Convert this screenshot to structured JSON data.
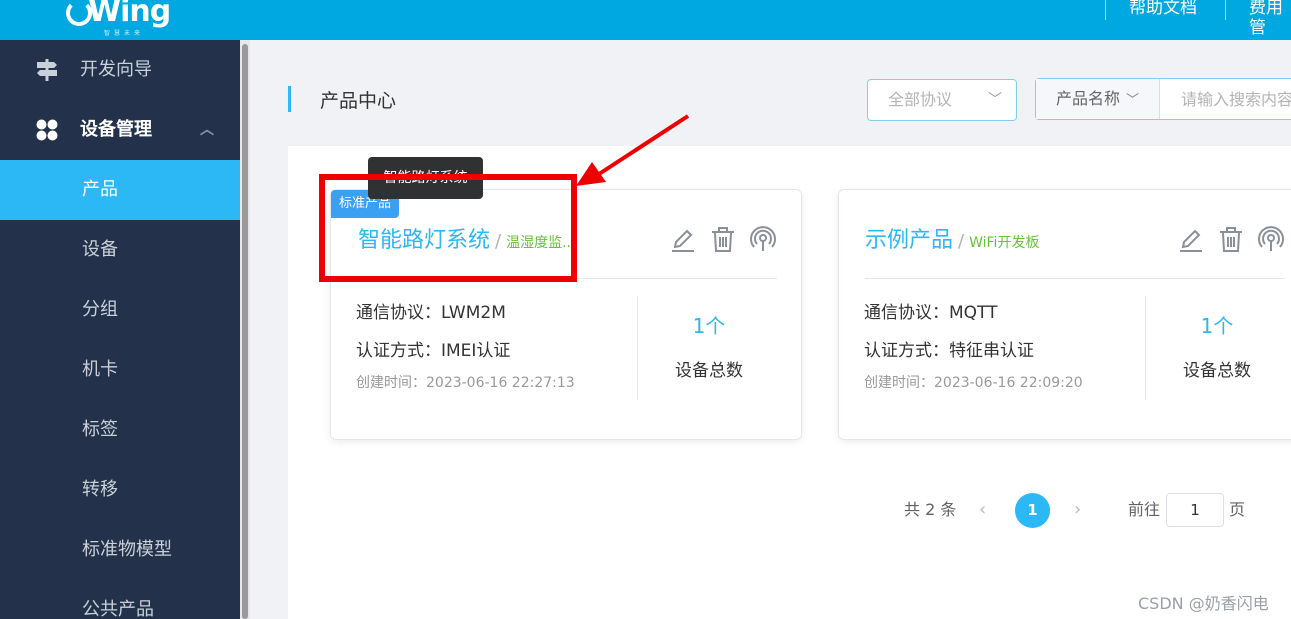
{
  "header": {
    "logo_text": "Wing",
    "logo_sub": "智慧未来",
    "links": [
      "帮助文档",
      "费用管"
    ]
  },
  "sidebar": {
    "items": [
      {
        "label": "开发向导",
        "icon": "signpost-icon"
      },
      {
        "label": "设备管理",
        "icon": "grid-icon"
      }
    ],
    "sub_items": [
      "产品",
      "设备",
      "分组",
      "机卡",
      "标签",
      "转移",
      "标准物模型",
      "公共产品"
    ],
    "active": "产品"
  },
  "main": {
    "title": "产品中心",
    "protocol_filter": {
      "placeholder": "全部协议"
    },
    "search": {
      "field": "产品名称",
      "placeholder": "请输入搜索内容"
    }
  },
  "tooltip": "智能路灯系统",
  "cards": [
    {
      "badge": "标准产品",
      "name": "智能路灯系统",
      "tag": "温湿度监...",
      "protocol_label": "通信协议：LWM2M",
      "auth_label": "认证方式：IMEI认证",
      "created": "创建时间：2023-06-16 22:27:13",
      "count": "1个",
      "count_label": "设备总数"
    },
    {
      "name": "示例产品",
      "tag": "WiFi开发板",
      "protocol_label": "通信协议：MQTT",
      "auth_label": "认证方式：特征串认证",
      "created": "创建时间：2023-06-16 22:09:20",
      "count": "1个",
      "count_label": "设备总数"
    }
  ],
  "pagination": {
    "total": "共 2 条",
    "current": "1",
    "goto_label": "前往",
    "goto_value": "1",
    "page_suffix": "页"
  },
  "watermark": "CSDN @奶香闪电",
  "colors": {
    "accent": "#2cb7f5",
    "header": "#00a8e1",
    "sidebar": "#23324a",
    "highlight": "#ee0000"
  }
}
